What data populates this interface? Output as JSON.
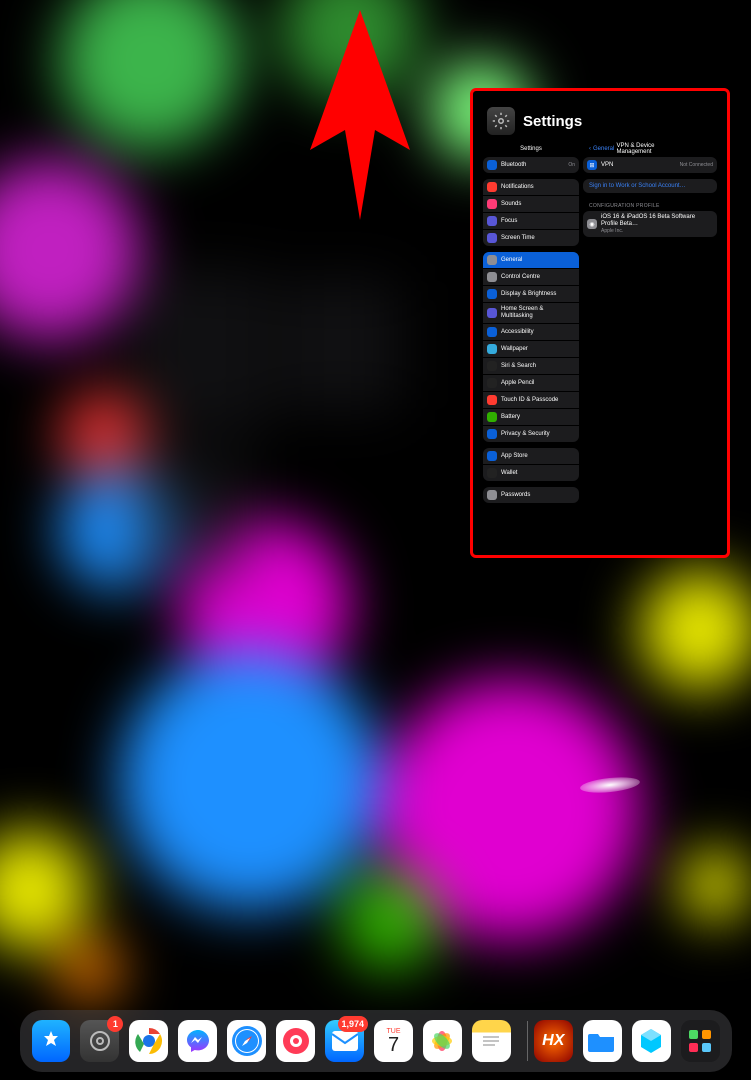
{
  "app": {
    "title": "Settings"
  },
  "sidebar": {
    "header": "Settings",
    "group1": [
      {
        "icon": "#0a60d8",
        "label": "Bluetooth",
        "value": "On"
      }
    ],
    "group2": [
      {
        "icon": "#ff3b30",
        "label": "Notifications"
      },
      {
        "icon": "#ff3b77",
        "label": "Sounds"
      },
      {
        "icon": "#5856d6",
        "label": "Focus"
      },
      {
        "icon": "#5856d6",
        "label": "Screen Time"
      }
    ],
    "group3": [
      {
        "icon": "#8e8e93",
        "label": "General",
        "selected": true
      },
      {
        "icon": "#8e8e93",
        "label": "Control Centre"
      },
      {
        "icon": "#0a60d8",
        "label": "Display & Brightness"
      },
      {
        "icon": "#5856d6",
        "label": "Home Screen & Multitasking"
      },
      {
        "icon": "#0a60d8",
        "label": "Accessibility"
      },
      {
        "icon": "#34aadc",
        "label": "Wallpaper"
      },
      {
        "icon": "#222",
        "label": "Siri & Search"
      },
      {
        "icon": "#222",
        "label": "Apple Pencil"
      },
      {
        "icon": "#ff3b30",
        "label": "Touch ID & Passcode"
      },
      {
        "icon": "#30b000",
        "label": "Battery"
      },
      {
        "icon": "#0a60d8",
        "label": "Privacy & Security"
      }
    ],
    "group4": [
      {
        "icon": "#0a60d8",
        "label": "App Store"
      },
      {
        "icon": "#222",
        "label": "Wallet"
      }
    ],
    "group5": [
      {
        "icon": "#8e8e93",
        "label": "Passwords"
      }
    ]
  },
  "detail": {
    "back": "General",
    "title": "VPN & Device Management",
    "vpn": {
      "label": "VPN",
      "value": "Not Connected",
      "icon": "#0a60d8"
    },
    "signin": "Sign in to Work or School Account…",
    "section": "CONFIGURATION PROFILE",
    "profile": {
      "label": "iOS 16 & iPadOS 16 Beta Software Profile Beta…",
      "sub": "Apple Inc."
    }
  },
  "dock": {
    "badges": {
      "settings": "1",
      "mail": "1,974"
    },
    "calendar": {
      "dow": "TUE",
      "day": "7"
    }
  }
}
